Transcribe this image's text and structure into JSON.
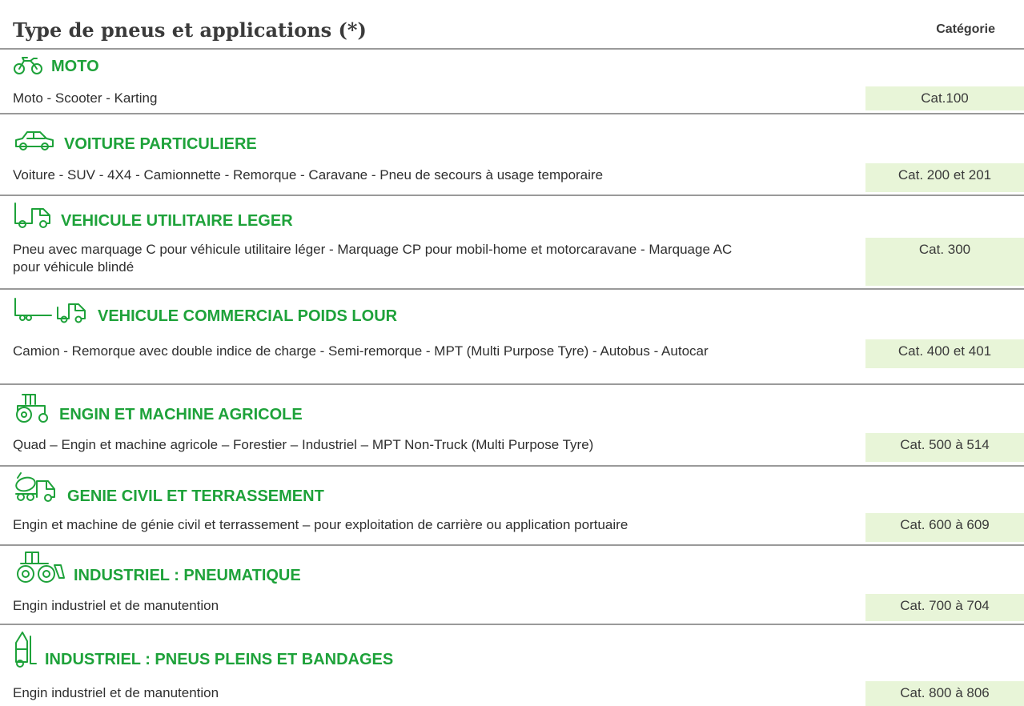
{
  "header": {
    "title": "Type de pneus et applications (*)",
    "column_label": "Catégorie"
  },
  "sections": [
    {
      "icon": "motorcycle-icon",
      "title": "MOTO",
      "description": "Moto - Scooter - Karting",
      "category": "Cat.100"
    },
    {
      "icon": "car-icon",
      "title": "VOITURE PARTICULIERE",
      "description": "Voiture - SUV - 4X4 - Camionnette - Remorque - Caravane - Pneu de secours à usage temporaire",
      "category": "Cat. 200 et 201"
    },
    {
      "icon": "van-icon",
      "title": "VEHICULE UTILITAIRE LEGER",
      "description": "Pneu avec marquage C pour véhicule utilitaire léger - Marquage CP pour mobil-home et motorcaravane - Marquage AC pour véhicule blindé",
      "category": "Cat. 300"
    },
    {
      "icon": "truck-trailer-icon",
      "title": "VEHICULE COMMERCIAL POIDS LOUR",
      "description": "Camion - Remorque avec double indice de charge - Semi-remorque - MPT (Multi Purpose Tyre) - Autobus - Autocar",
      "category": "Cat. 400 et 401"
    },
    {
      "icon": "tractor-icon",
      "title": "ENGIN ET MACHINE AGRICOLE",
      "description": "Quad – Engin et machine agricole – Forestier – Industriel – MPT Non-Truck (Multi Purpose Tyre)",
      "category": "Cat. 500 à 514"
    },
    {
      "icon": "cement-mixer-icon",
      "title": "GENIE CIVIL ET TERRASSEMENT",
      "description": "Engin et machine de génie civil et terrassement – pour exploitation de carrière ou application portuaire",
      "category": "Cat. 600 à 609"
    },
    {
      "icon": "industrial-loader-icon",
      "title": "INDUSTRIEL : PNEUMATIQUE",
      "description": "Engin industriel et de manutention",
      "category": "Cat. 700 à 704"
    },
    {
      "icon": "forklift-icon",
      "title": "INDUSTRIEL : PNEUS PLEINS ET BANDAGES",
      "description": "Engin industriel et de manutention",
      "category": "Cat. 800 à 806"
    }
  ],
  "colors": {
    "accent": "#1ea23a",
    "category_bg": "#e8f5d8",
    "divider": "#9a9a9a"
  }
}
